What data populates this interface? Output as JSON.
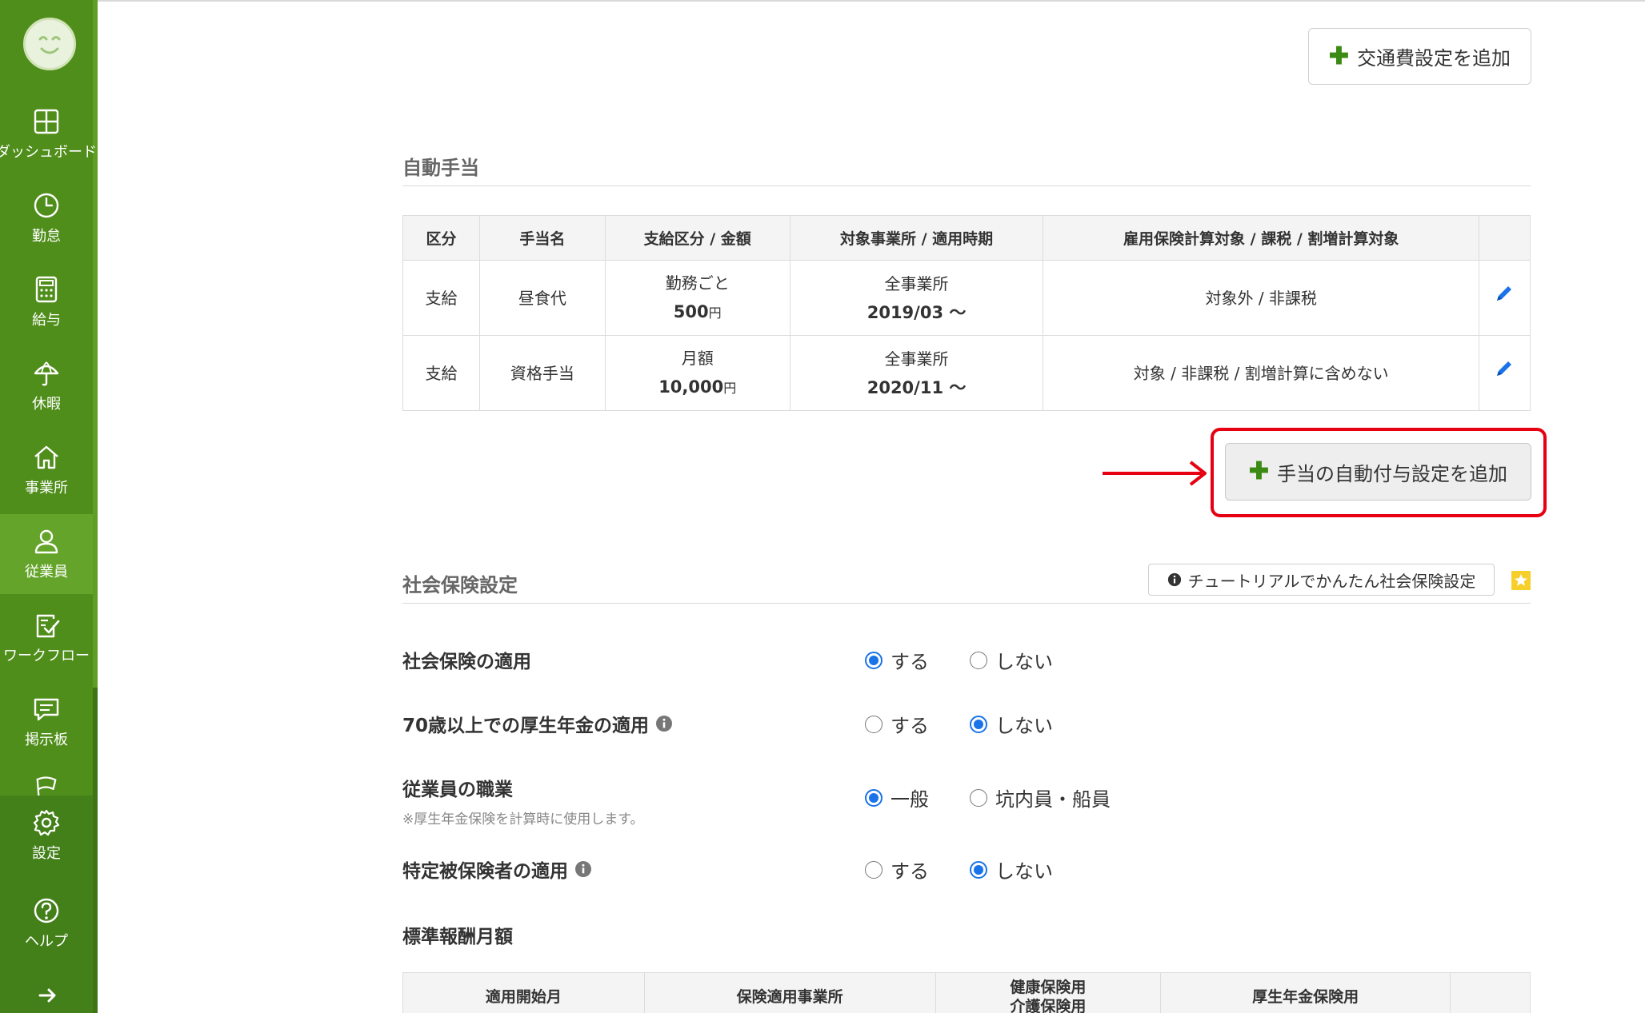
{
  "sidebar": {
    "items": [
      {
        "label": "ダッシュボード",
        "icon": "dashboard-icon"
      },
      {
        "label": "勤怠",
        "icon": "clock-icon"
      },
      {
        "label": "給与",
        "icon": "calculator-icon"
      },
      {
        "label": "休暇",
        "icon": "umbrella-icon"
      },
      {
        "label": "事業所",
        "icon": "home-icon"
      },
      {
        "label": "従業員",
        "icon": "person-icon",
        "active": true
      },
      {
        "label": "ワークフロー",
        "icon": "clipboard-check-icon"
      },
      {
        "label": "掲示板",
        "icon": "message-icon"
      },
      {
        "label": "設定",
        "icon": "gear-icon"
      },
      {
        "label": "ヘルプ",
        "icon": "help-icon"
      }
    ]
  },
  "buttons": {
    "add_commute": "交通費設定を追加",
    "add_auto_allowance": "手当の自動付与設定を追加",
    "tutorial": "チュートリアルでかんたん社会保険設定"
  },
  "auto_allowance": {
    "title": "自動手当",
    "headers": [
      "区分",
      "手当名",
      "支給区分 / 金額",
      "対象事業所 / 適用時期",
      "雇用保険計算対象 / 課税 / 割増計算対象",
      ""
    ],
    "rows": [
      {
        "kubun": "支給",
        "name": "昼食代",
        "pay_type": "勤務ごと",
        "amount": "500",
        "unit": "円",
        "office": "全事業所",
        "period": "2019/03 〜",
        "targets": "対象外 / 非課税"
      },
      {
        "kubun": "支給",
        "name": "資格手当",
        "pay_type": "月額",
        "amount": "10,000",
        "unit": "円",
        "office": "全事業所",
        "period": "2020/11 〜",
        "targets": "対象 / 非課税 / 割増計算に含めない"
      }
    ]
  },
  "social_insurance": {
    "title": "社会保険設定",
    "fields": [
      {
        "label": "社会保険の適用",
        "options": [
          "する",
          "しない"
        ],
        "selected": "する",
        "info": false
      },
      {
        "label": "70歳以上での厚生年金の適用",
        "options": [
          "する",
          "しない"
        ],
        "selected": "しない",
        "info": true
      },
      {
        "label": "従業員の職業",
        "note": "※厚生年金保険を計算時に使用します。",
        "options": [
          "一般",
          "坑内員・船員"
        ],
        "selected": "一般",
        "info": false
      },
      {
        "label": "特定被保険者の適用",
        "options": [
          "する",
          "しない"
        ],
        "selected": "しない",
        "info": true
      }
    ],
    "standard_salary": {
      "title": "標準報酬月額",
      "headers": [
        "適用開始月",
        "保険適用事業所",
        "健康保険用",
        "介護保険用",
        "厚生年金保険用"
      ]
    }
  },
  "colors": {
    "sidebar": "#4f8e1a",
    "accent_green": "#3a8a14",
    "highlight_red": "#e60012",
    "radio_blue": "#1a73e8"
  }
}
